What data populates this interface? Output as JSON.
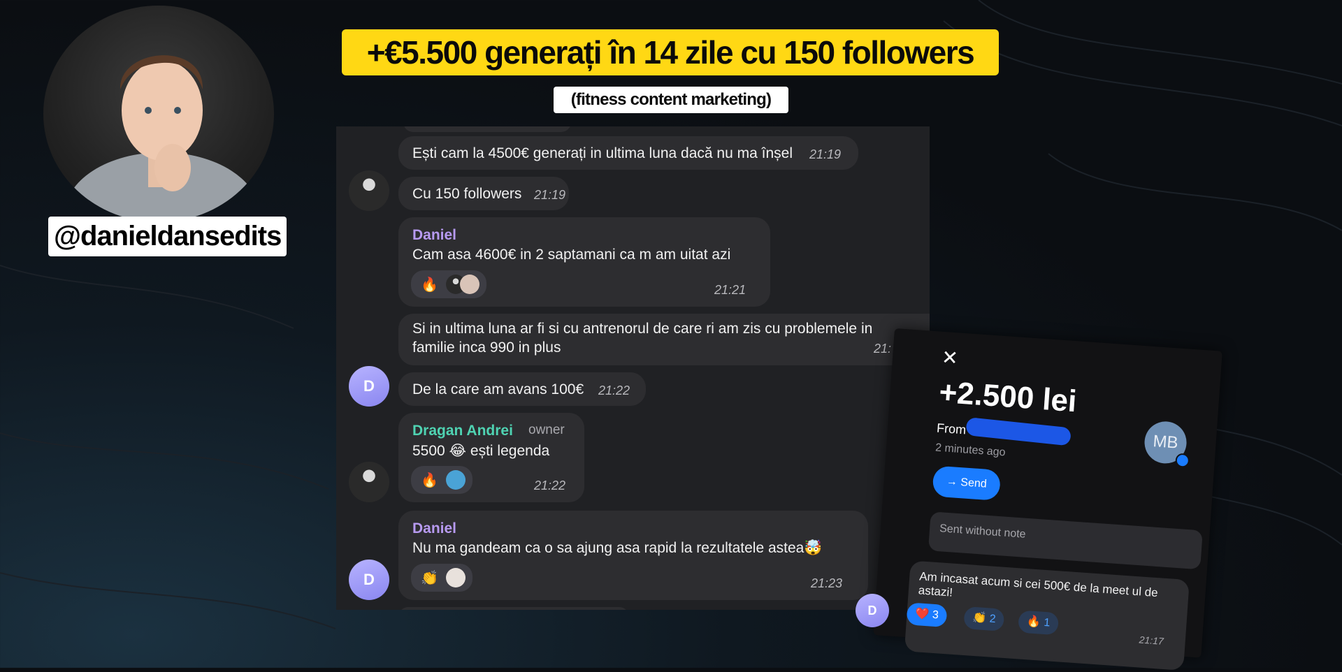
{
  "profile": {
    "handle": "@danieldansedits"
  },
  "headline": {
    "title": "+€5.500 generați în 14 zile cu 150 followers",
    "subtitle": "(fitness content marketing)"
  },
  "chat": {
    "messages": [
      {
        "text": "Ești cam la 4500€ generați in ultima luna dacă nu ma înșel",
        "time": "21:19"
      },
      {
        "text": "Cu 150 followers",
        "time": "21:19"
      },
      {
        "sender": "Daniel",
        "text": "Cam asa 4600€ in 2 saptamani ca m am uitat azi",
        "time": "21:21",
        "reaction_emoji": "🔥"
      },
      {
        "text": "Si in ultima luna ar fi si cu antrenorul de care ri am zis cu problemele in",
        "text2": "familie inca 990 in plus",
        "time": "21:"
      },
      {
        "text": "De la care am avans 100€",
        "time": "21:22"
      },
      {
        "sender": "Dragan Andrei",
        "role": "owner",
        "text": "5500 😂 ești legenda",
        "time": "21:22",
        "reaction_emoji": "🔥"
      },
      {
        "sender": "Daniel",
        "text": "Nu ma gandeam ca o sa ajung asa rapid la rezultatele astea🤯",
        "time": "21:23",
        "reaction_emoji": "👏"
      }
    ],
    "avatar_letter": "D",
    "colors": {
      "daniel": "#b79af0",
      "dragan": "#4fd3b2",
      "bubble": "#2d2d30",
      "panel": "#202124"
    }
  },
  "payment": {
    "close_icon": "✕",
    "amount": "+2.500 lei",
    "from_label": "From",
    "ago": "2 minutes ago",
    "avatar_initials": "MB",
    "send_label": "Send",
    "send_icon": "→",
    "note_placeholder": "Sent without note",
    "message": "Am incasat acum si cei 500€ de la meet ul de astazi!",
    "reactions": [
      {
        "emoji": "❤️",
        "count": "3"
      },
      {
        "emoji": "👏",
        "count": "2"
      },
      {
        "emoji": "🔥",
        "count": "1"
      }
    ],
    "time": "21:17",
    "sender_letter": "D"
  }
}
